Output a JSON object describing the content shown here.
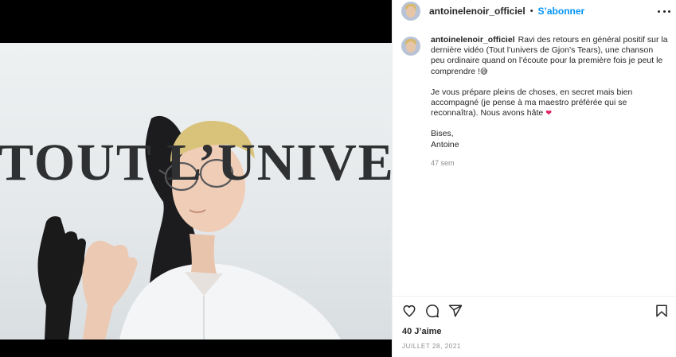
{
  "post": {
    "username": "antoinelenoir_officiel",
    "separator": "•",
    "follow_label": "S’abonner",
    "media": {
      "overlay_text": "TOUT L’UNIVERS",
      "alt_subject": "young man with glasses in white shirt"
    },
    "caption": {
      "author": "antoinelenoir_officiel",
      "para1": "Ravi des retours en général positif sur la dernière vidéo (Tout l’univers de Gjon’s Tears), une chanson peu ordinaire quand on l’écoute pour la première fois je peut le comprendre !",
      "para1_emoji": "😅",
      "para2": "Je vous prépare pleins de choses, en secret mais bien accompagné (je pense à ma maestro préférée qui se reconnaîtra). Nous avons hâte",
      "para2_emoji": "❤",
      "sign_line1": "Bises,",
      "sign_line2": "Antoine"
    },
    "time_ago": "47 sem",
    "likes": "40 J’aime",
    "date": "JUILLET 28, 2021"
  },
  "icons": {
    "like": "heart-icon",
    "comment": "comment-icon",
    "share": "paper-plane-icon",
    "save": "bookmark-icon",
    "more": "more-options-icon"
  },
  "colors": {
    "link_blue": "#0095f6",
    "text": "#262626",
    "muted": "#8e8e8e",
    "heart_red": "#e0245e"
  }
}
